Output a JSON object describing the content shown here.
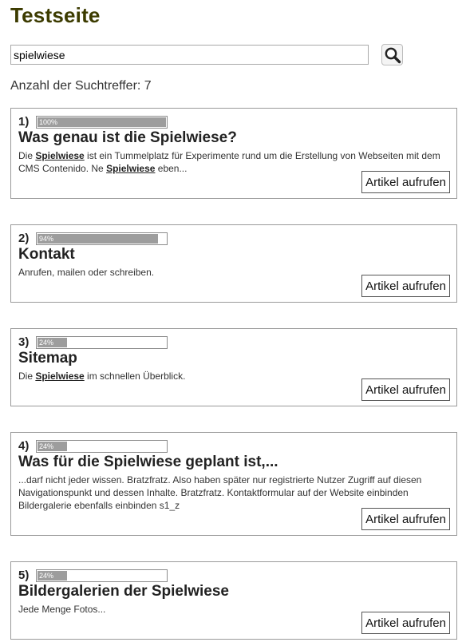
{
  "page": {
    "title": "Testseite"
  },
  "search": {
    "value": "spielwiese",
    "button_icon": "search-icon"
  },
  "results_info": {
    "label": "Anzahl der Suchtreffer: 7"
  },
  "results": [
    {
      "rank": "1)",
      "relevance_percent": 100,
      "relevance_label": "100%",
      "title": "Was genau ist die Spielwiese?",
      "snippet": {
        "s0": "Die ",
        "h0": "Spielwiese",
        "s1": " ist ein Tummelplatz für Experimente rund um die Erstellung von Webseiten mit dem CMS Contenido. Ne ",
        "h1": "Spielwiese",
        "s2": " eben..."
      },
      "button": "Artikel aufrufen"
    },
    {
      "rank": "2)",
      "relevance_percent": 94,
      "relevance_label": "94%",
      "title": "Kontakt",
      "snippet": {
        "s0": "Anrufen, mailen oder schreiben."
      },
      "button": "Artikel aufrufen"
    },
    {
      "rank": "3)",
      "relevance_percent": 24,
      "relevance_label": "24%",
      "title": "Sitemap",
      "snippet": {
        "s0": "Die ",
        "h0": "Spielwiese",
        "s1": " im schnellen Überblick."
      },
      "button": "Artikel aufrufen"
    },
    {
      "rank": "4)",
      "relevance_percent": 24,
      "relevance_label": "24%",
      "title": "Was für die Spielwiese geplant ist,...",
      "snippet": {
        "s0": "...darf nicht jeder wissen. Bratzfratz. Also haben später nur registrierte Nutzer Zugriff auf diesen Navigationspunkt und dessen Inhalte. Bratzfratz. Kontaktformular auf der Website einbinden Bildergalerie ebenfalls einbinden s1_z"
      },
      "button": "Artikel aufrufen"
    },
    {
      "rank": "5)",
      "relevance_percent": 24,
      "relevance_label": "24%",
      "title": "Bildergalerien der Spielwiese",
      "snippet": {
        "s0": "Jede Menge Fotos..."
      },
      "button": "Artikel aufrufen"
    }
  ],
  "colors": {
    "title": "#3c3b00",
    "bar_fill": "#9d9d9d",
    "border": "#9a9a9a",
    "text": "#222222"
  }
}
